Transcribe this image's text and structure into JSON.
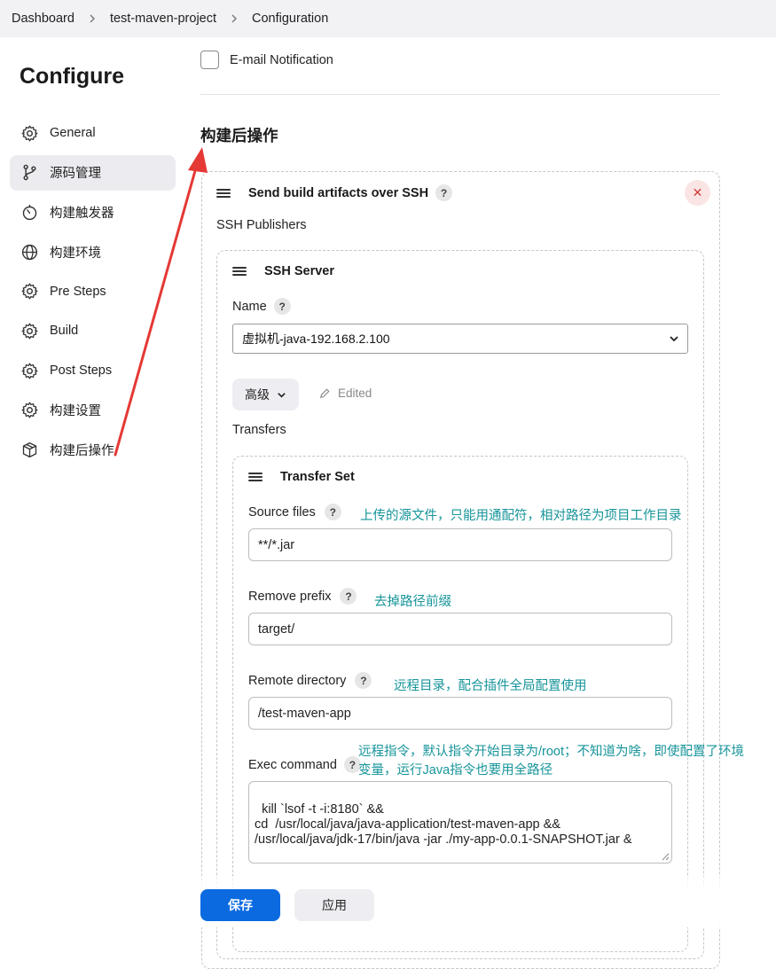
{
  "breadcrumb": [
    "Dashboard",
    "test-maven-project",
    "Configuration"
  ],
  "page_title": "Configure",
  "sidebar": {
    "items": [
      {
        "label": "General",
        "icon": "gear-icon"
      },
      {
        "label": "源码管理",
        "icon": "branch-icon",
        "active": true
      },
      {
        "label": "构建触发器",
        "icon": "timer-icon"
      },
      {
        "label": "构建环境",
        "icon": "globe-icon"
      },
      {
        "label": "Pre Steps",
        "icon": "gear-icon"
      },
      {
        "label": "Build",
        "icon": "gear-icon"
      },
      {
        "label": "Post Steps",
        "icon": "gear-icon"
      },
      {
        "label": "构建设置",
        "icon": "gear-icon"
      },
      {
        "label": "构建后操作",
        "icon": "package-icon"
      }
    ]
  },
  "email_notification": {
    "label": "E-mail Notification",
    "checked": false
  },
  "section_title": "构建后操作",
  "publisher": {
    "title": "Send build artifacts over SSH",
    "subtitle": "SSH Publishers",
    "close_symbol": "✕",
    "help_symbol": "?"
  },
  "server": {
    "title": "SSH Server",
    "name_label": "Name",
    "name_value": "虚拟机-java-192.168.2.100",
    "advanced_label": "高级",
    "edited_label": "Edited",
    "transfers_label": "Transfers"
  },
  "transfer": {
    "title": "Transfer Set",
    "source_files_label": "Source files",
    "source_files_value": "**/*.jar",
    "remove_prefix_label": "Remove prefix",
    "remove_prefix_value": "target/",
    "remote_directory_label": "Remote directory",
    "remote_directory_value": "/test-maven-app",
    "exec_command_label": "Exec command",
    "exec_command_value": "kill `lsof -t -i:8180` &&\ncd  /usr/local/java/java-application/test-maven-app &&\n/usr/local/java/jdk-17/bin/java -jar ./my-app-0.0.1-SNAPSHOT.jar &"
  },
  "annotations": {
    "source_files_note": "上传的源文件，只能用通配符，相对路径为项目工作目录",
    "remove_prefix_note": "去掉路径前缀",
    "remote_directory_note": "远程目录，配合插件全局配置使用",
    "exec_command_note_line1": "远程指令，默认指令开始目录为/root；不知道为啥，即使配置了环境",
    "exec_command_note_line2": "变量，运行Java指令也要用全路径",
    "note_color": "#16949a",
    "arrow_color": "#e53935"
  },
  "footer": {
    "save_label": "保存",
    "apply_label": "应用"
  },
  "colors": {
    "primary": "#0b6ae0",
    "danger": "#d13b3b"
  }
}
